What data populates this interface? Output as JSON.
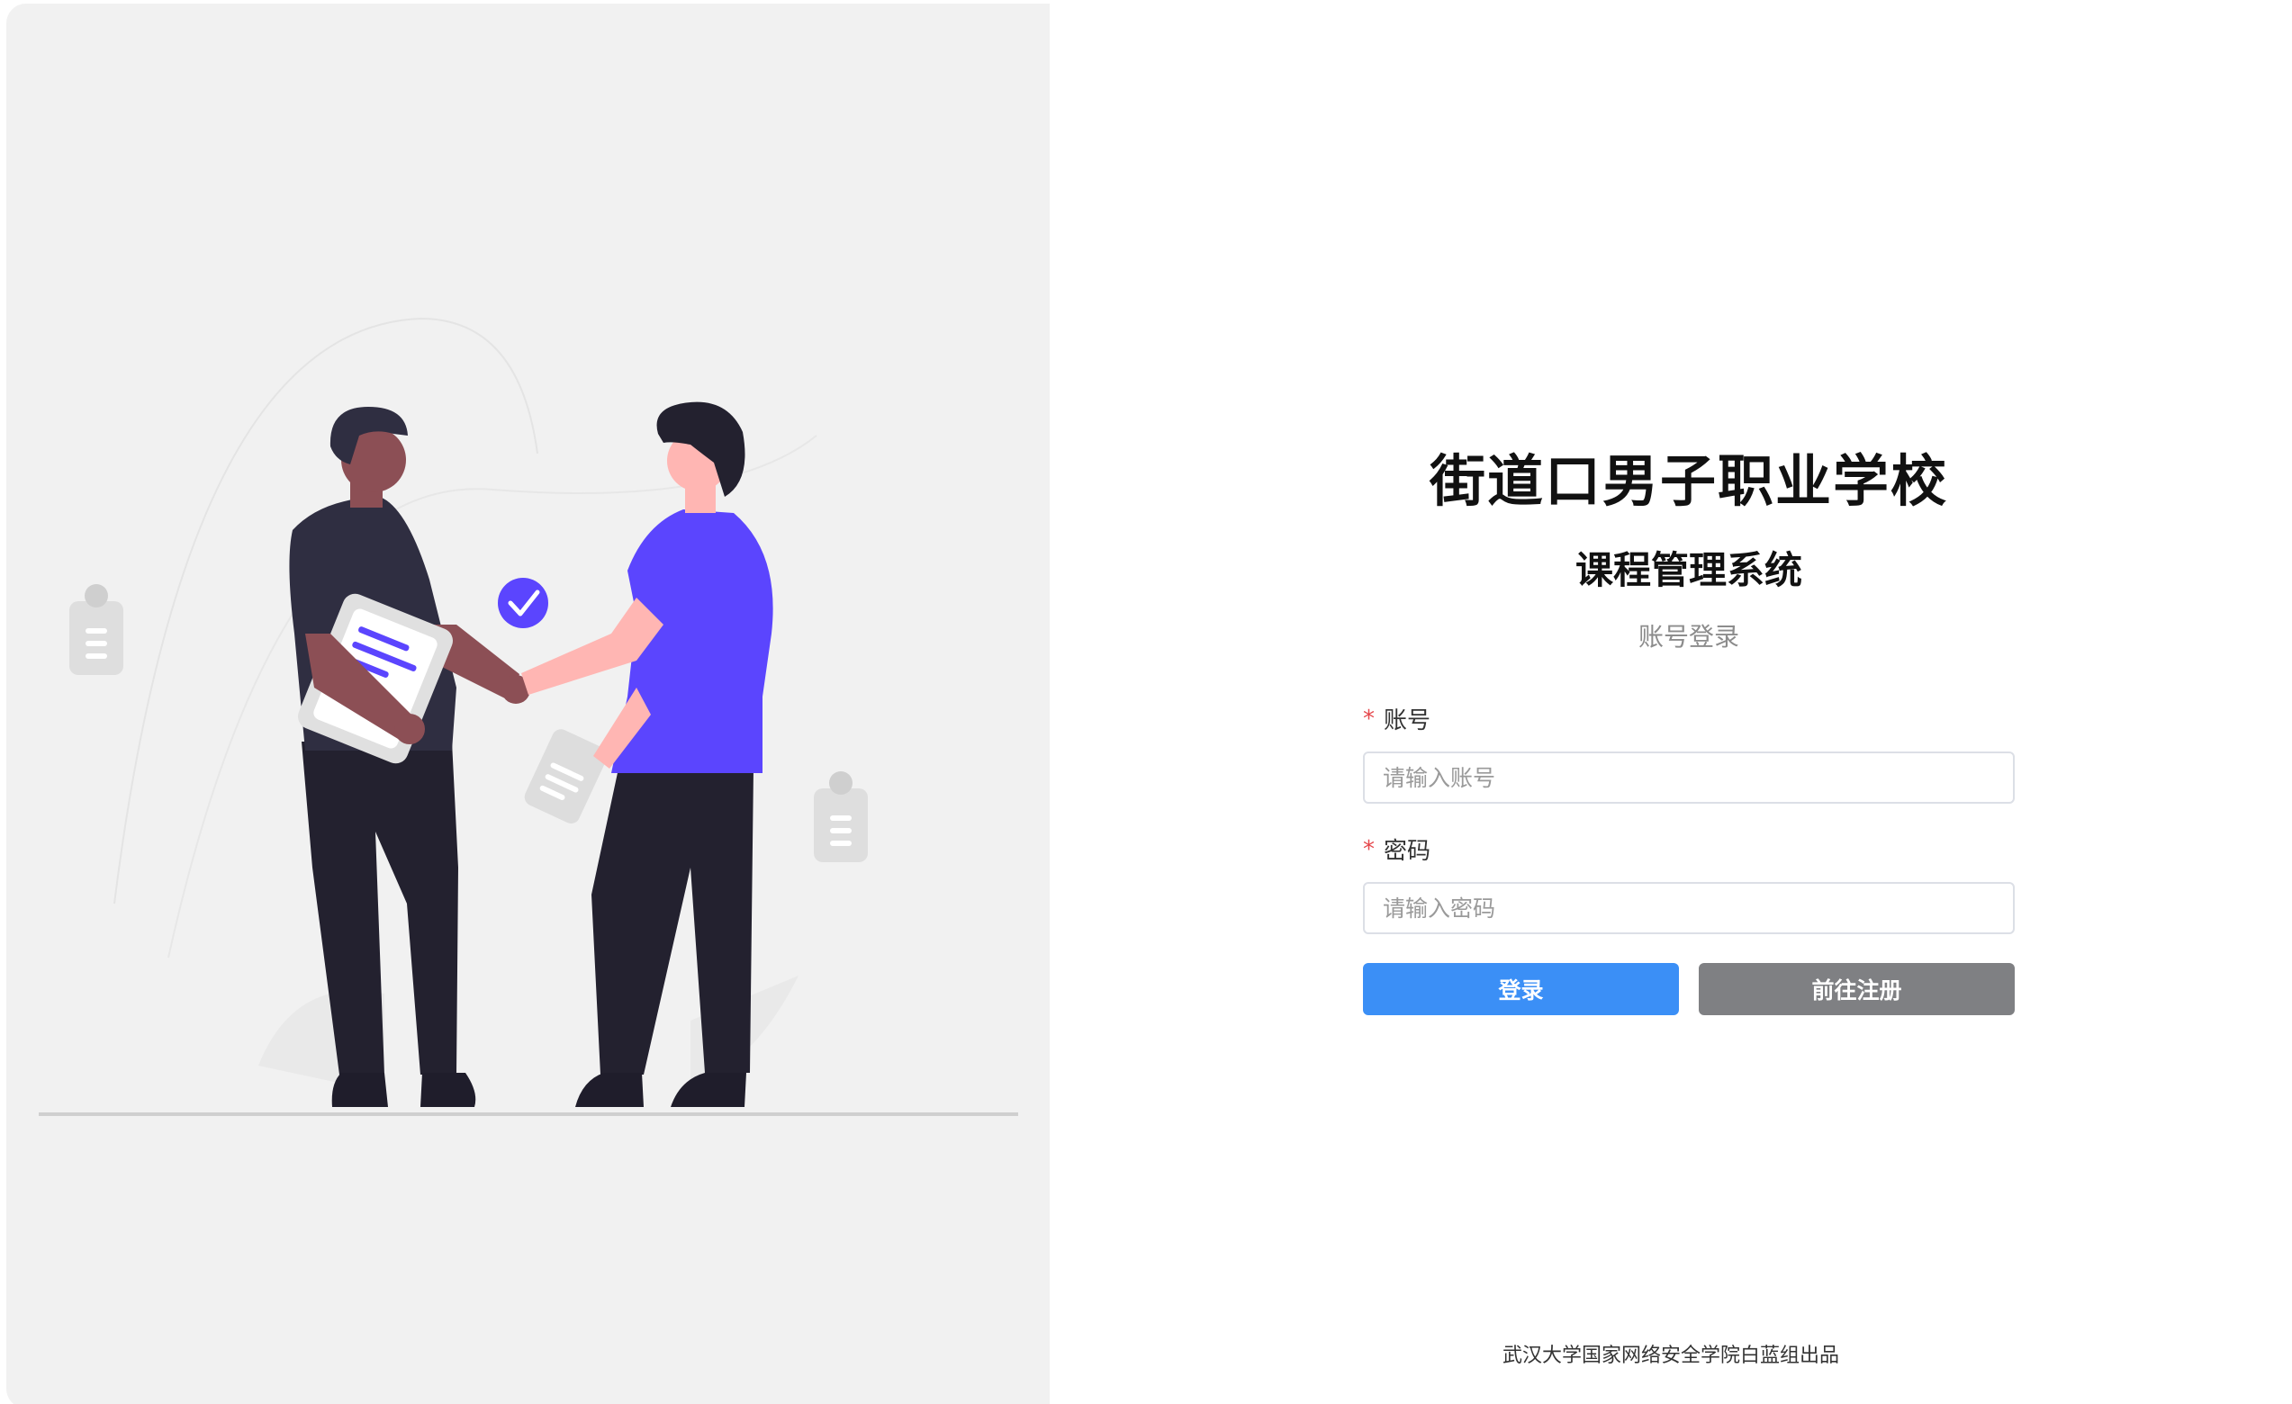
{
  "school_title": "街道口男子职业学校",
  "system_title": "课程管理系统",
  "login_subtitle": "账号登录",
  "form": {
    "account": {
      "label": "账号",
      "required_mark": "*",
      "placeholder": "请输入账号",
      "value": ""
    },
    "password": {
      "label": "密码",
      "required_mark": "*",
      "placeholder": "请输入密码",
      "value": ""
    }
  },
  "buttons": {
    "login_label": "登录",
    "register_label": "前往注册"
  },
  "footer_text": "武汉大学国家网络安全学院白蓝组出品",
  "colors": {
    "left_panel_bg": "#f1f1f1",
    "login_button": "#3b8ff6",
    "register_button": "#7f8083",
    "required_mark": "#e5484d",
    "accent_purple": "#5b45fe"
  },
  "illustration": {
    "name": "handshake-illustration",
    "icons": [
      "check-badge-icon",
      "clipboard-icon",
      "document-icon"
    ]
  }
}
